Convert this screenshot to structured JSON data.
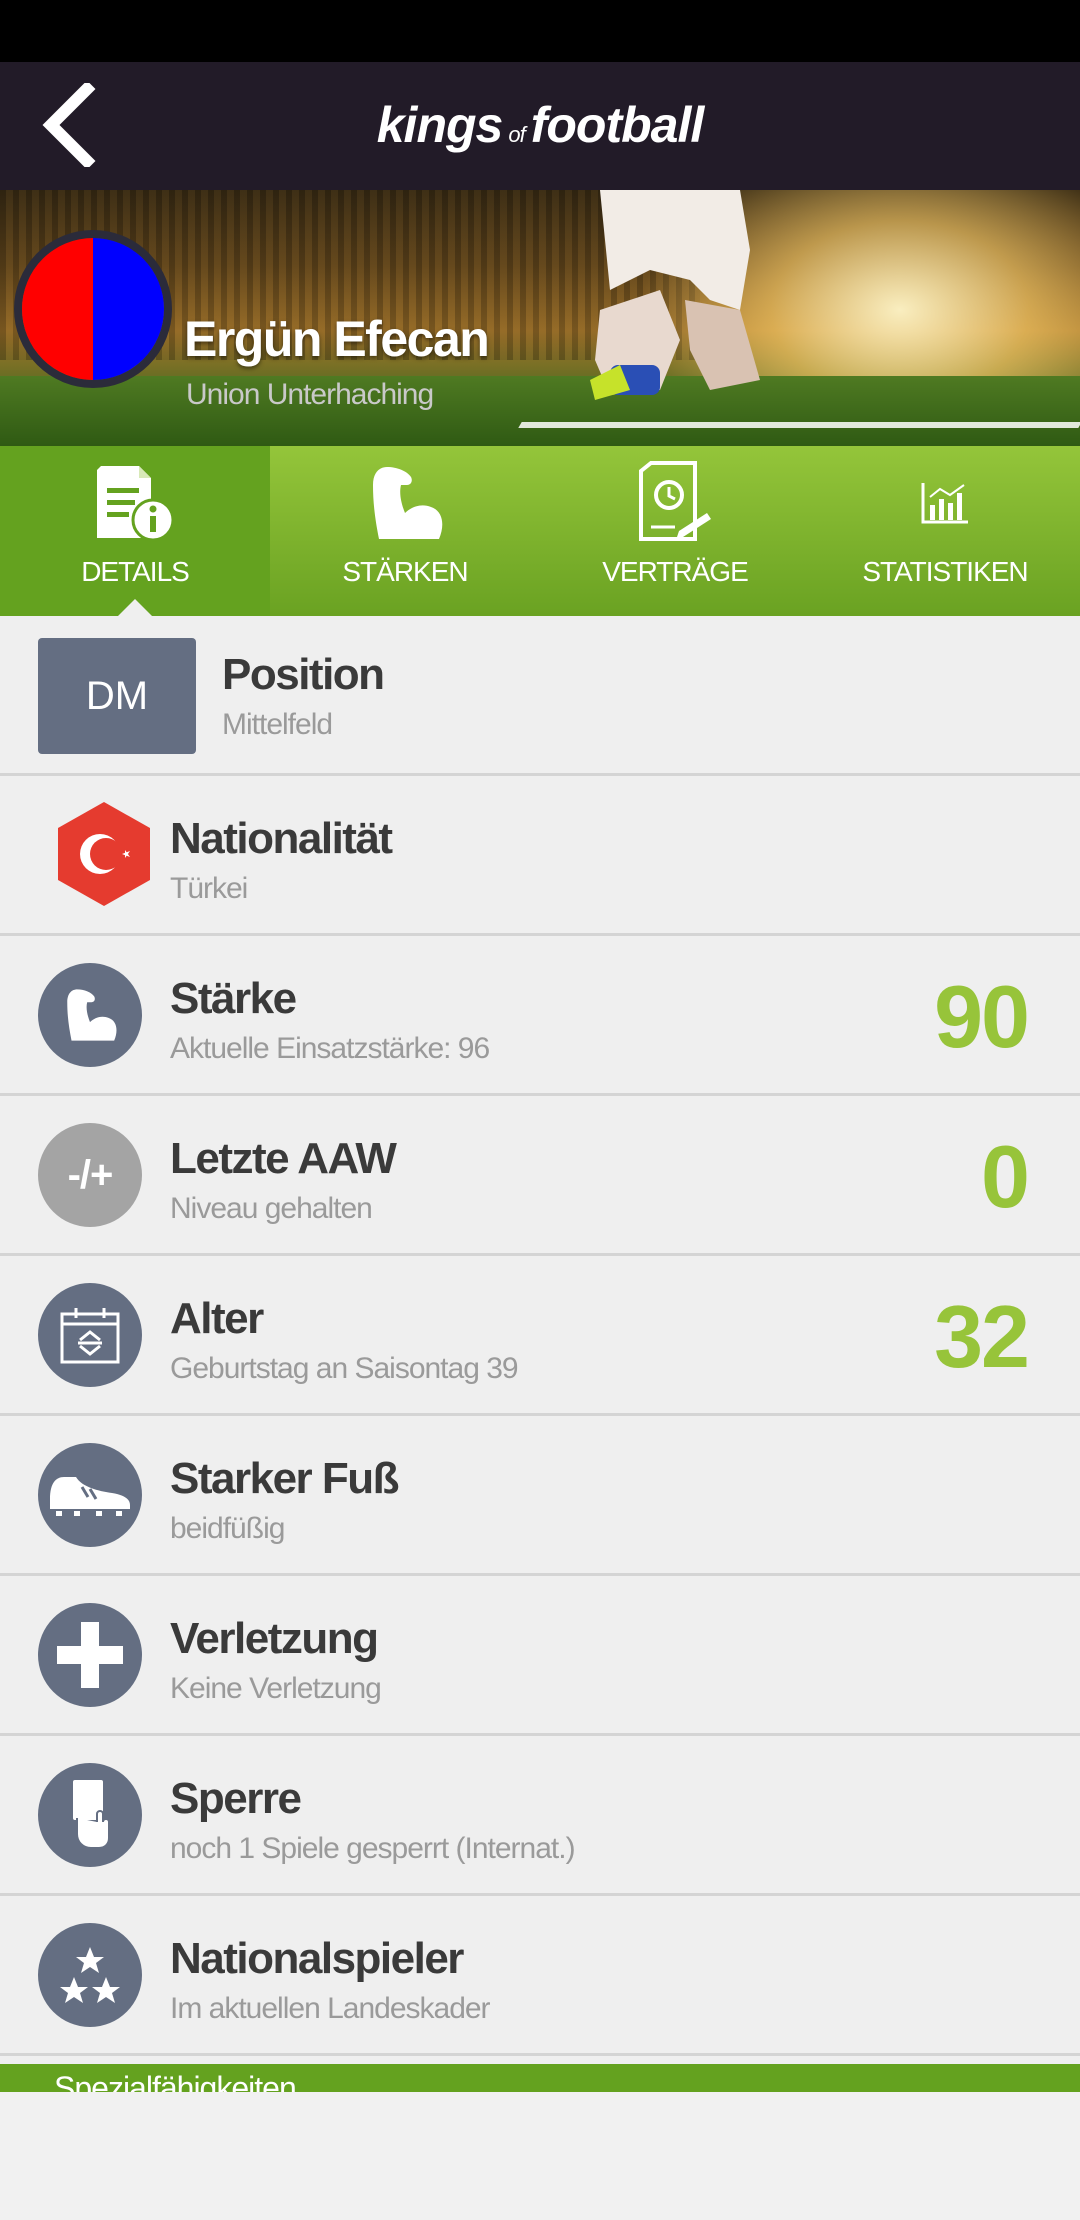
{
  "app": {
    "logo_main_left": "kings",
    "logo_of": "of",
    "logo_main_right": "football"
  },
  "player": {
    "name": "Ergün Efecan",
    "club": "Union Unterhaching"
  },
  "tabs": [
    {
      "label": "DETAILS",
      "icon": "document-info-icon",
      "active": true
    },
    {
      "label": "STÄRKEN",
      "icon": "muscle-icon",
      "active": false
    },
    {
      "label": "VERTRÄGE",
      "icon": "contract-icon",
      "active": false
    },
    {
      "label": "STATISTIKEN",
      "icon": "chart-icon",
      "active": false
    }
  ],
  "details": {
    "position": {
      "badge": "DM",
      "title": "Position",
      "sub": "Mittelfeld"
    },
    "nationality": {
      "title": "Nationalität",
      "sub": "Türkei"
    },
    "strength": {
      "title": "Stärke",
      "sub": "Aktuelle Einsatzstärke: 96",
      "value": "90"
    },
    "last_aaw": {
      "icon_text": "-/+",
      "title": "Letzte AAW",
      "sub": "Niveau gehalten",
      "value": "0"
    },
    "age": {
      "title": "Alter",
      "sub": "Geburtstag an Saisontag 39",
      "value": "32"
    },
    "foot": {
      "title": "Starker Fuß",
      "sub": "beidfüßig"
    },
    "injury": {
      "title": "Verletzung",
      "sub": "Keine Verletzung"
    },
    "suspension": {
      "title": "Sperre",
      "sub": "noch 1 Spiele gesperrt (Internat.)"
    },
    "national_player": {
      "title": "Nationalspieler",
      "sub": "Im aktuellen Landeskader"
    }
  },
  "bottom": {
    "label": "Spezialfähigkeiten"
  },
  "colors": {
    "accent_green": "#97c43a",
    "tab_green": "#64a21f",
    "icon_gray": "#646e82",
    "app_bar": "#221b28"
  }
}
